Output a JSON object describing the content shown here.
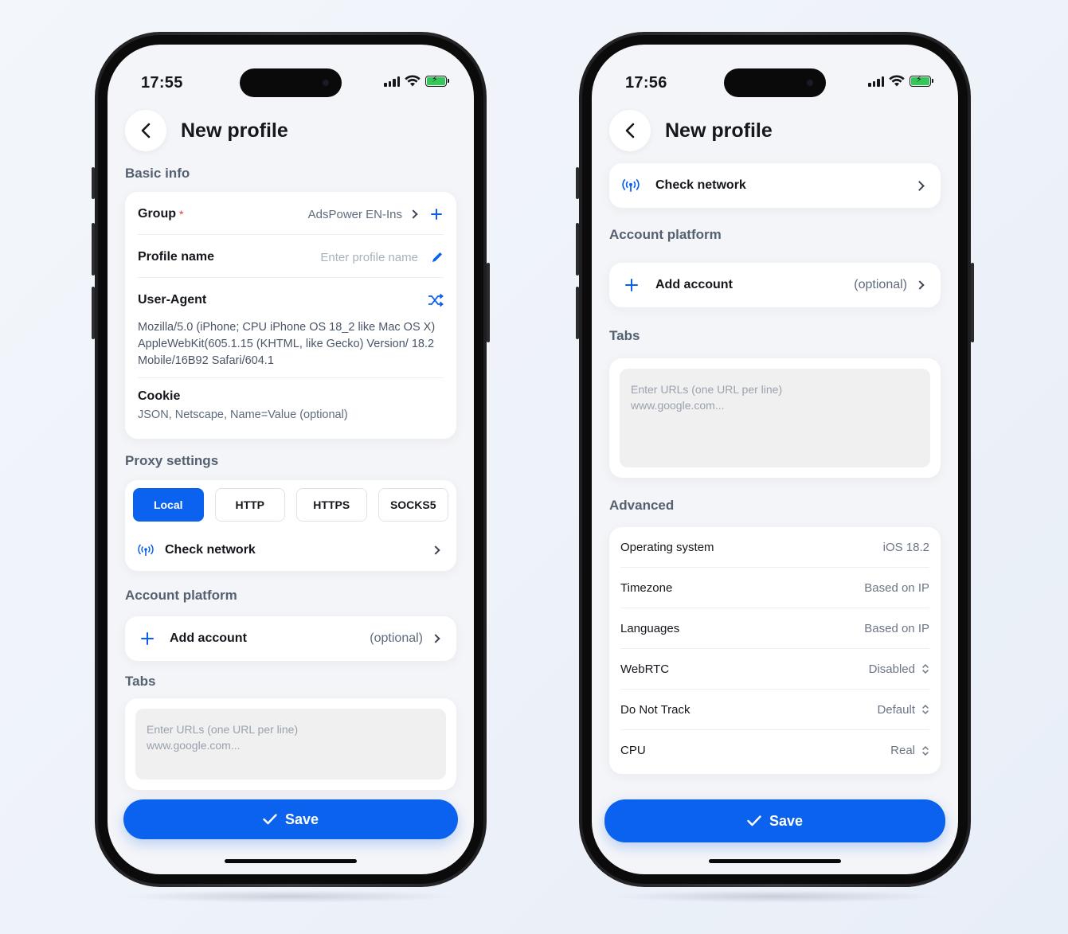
{
  "colors": {
    "accent": "#0a62ee",
    "required": "#e53935",
    "battery": "#34c759"
  },
  "left": {
    "time": "17:55",
    "title": "New profile",
    "basic_info": {
      "label": "Basic info",
      "group_label": "Group",
      "group_required": "*",
      "group_value": "AdsPower EN-Ins",
      "profile_name_label": "Profile name",
      "profile_name_placeholder": "Enter profile name",
      "user_agent_label": "User-Agent",
      "user_agent_value": "Mozilla/5.0 (iPhone; CPU iPhone OS 18_2 like Mac OS X) AppleWebKit(605.1.15 (KHTML, like Gecko) Version/ 18.2 Mobile/16B92 Safari/604.1",
      "cookie_label": "Cookie",
      "cookie_placeholder": "JSON, Netscape, Name=Value (optional)"
    },
    "proxy": {
      "label": "Proxy settings",
      "options": [
        "Local",
        "HTTP",
        "HTTPS",
        "SOCKS5"
      ],
      "selected": "Local",
      "check_network": "Check network"
    },
    "account": {
      "label": "Account platform",
      "add_account": "Add account",
      "optional": "(optional)"
    },
    "tabs": {
      "label": "Tabs",
      "placeholder": "Enter URLs (one URL per line)\nwww.google.com..."
    },
    "save_label": "Save"
  },
  "right": {
    "time": "17:56",
    "title": "New profile",
    "check_network": "Check network",
    "account": {
      "label": "Account platform",
      "add_account": "Add account",
      "optional": "(optional)"
    },
    "tabs": {
      "label": "Tabs",
      "placeholder": "Enter URLs (one URL per line)\nwww.google.com..."
    },
    "advanced": {
      "label": "Advanced",
      "rows": [
        {
          "label": "Operating system",
          "value": "iOS 18.2"
        },
        {
          "label": "Timezone",
          "value": "Based on IP"
        },
        {
          "label": "Languages",
          "value": "Based on IP"
        },
        {
          "label": "WebRTC",
          "value": "Disabled"
        },
        {
          "label": "Do Not Track",
          "value": "Default"
        },
        {
          "label": "CPU",
          "value": "Real"
        }
      ]
    },
    "save_label": "Save"
  }
}
